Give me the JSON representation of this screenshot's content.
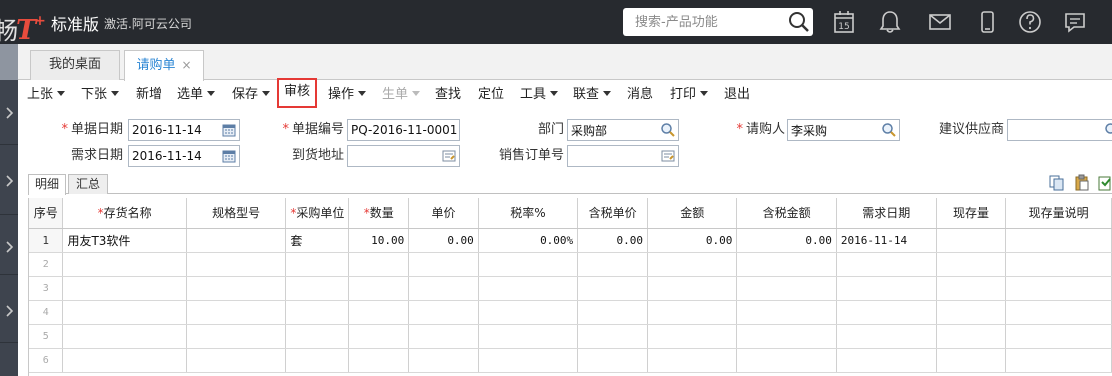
{
  "app": {
    "logo_text": "T",
    "logo_prefix": "畅",
    "logo_sup": "+",
    "edition": "标准版",
    "company": "激活.阿可云公司",
    "search_placeholder": "搜索-产品功能",
    "calendar_day": "15"
  },
  "colors": {
    "accent": "#2b86d4",
    "brand": "#e84c3d",
    "highlight": "#e53935",
    "topbar": "#272a2f"
  },
  "tabs": [
    {
      "label": "我的桌面"
    },
    {
      "label": "请购单",
      "close": "×"
    }
  ],
  "toolbar": {
    "prev": "上张",
    "next": "下张",
    "new": "新增",
    "select": "选单",
    "save": "保存",
    "audit": "审核",
    "ops": "操作",
    "generate": "生单",
    "find": "查找",
    "locate": "定位",
    "tools": "工具",
    "linked": "联查",
    "message": "消息",
    "print": "打印",
    "exit": "退出"
  },
  "form": {
    "doc_date_label": "单据日期",
    "doc_date": "2016-11-14",
    "doc_no_label": "单据编号",
    "doc_no": "PQ-2016-11-0001",
    "dept_label": "部门",
    "dept": "采购部",
    "requester_label": "请购人",
    "requester": "李采购",
    "supplier_label": "建议供应商",
    "supplier": "",
    "need_date_label": "需求日期",
    "need_date": "2016-11-14",
    "address_label": "到货地址",
    "address": "",
    "sales_order_label": "销售订单号",
    "sales_order": ""
  },
  "subtabs": [
    {
      "label": "明细"
    },
    {
      "label": "汇总"
    }
  ],
  "grid": {
    "columns": [
      "序号",
      "存货名称",
      "规格型号",
      "采购单位",
      "数量",
      "单价",
      "税率%",
      "含税单价",
      "金额",
      "含税金额",
      "需求日期",
      "现存量",
      "现存量说明"
    ],
    "rows": [
      [
        "1",
        "用友T3软件",
        "",
        "套",
        "10.00",
        "0.00",
        "0.00%",
        "0.00",
        "0.00",
        "0.00",
        "2016-11-14",
        "",
        ""
      ]
    ],
    "empty_rows": [
      "2",
      "3",
      "4",
      "5",
      "6"
    ]
  }
}
